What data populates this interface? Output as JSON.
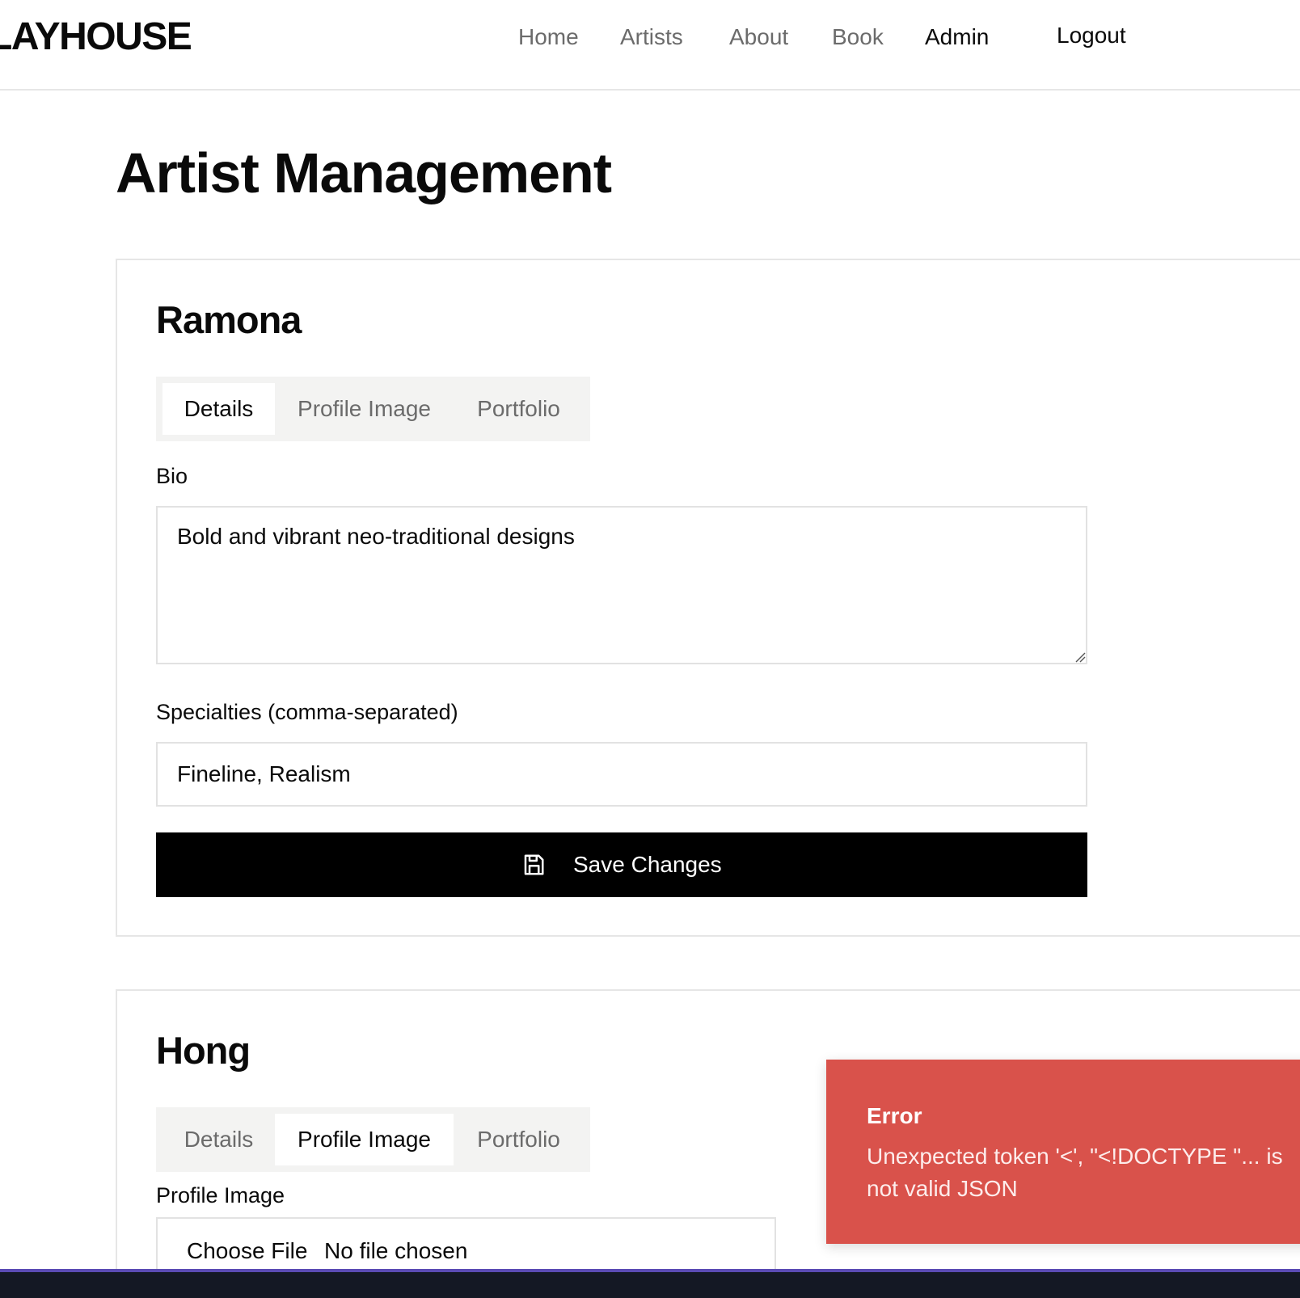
{
  "header": {
    "logo": "LAYHOUSE",
    "nav": {
      "home": "Home",
      "artists": "Artists",
      "about": "About",
      "book": "Book",
      "admin": "Admin"
    },
    "logout": "Logout"
  },
  "page": {
    "title": "Artist Management"
  },
  "artists": [
    {
      "name": "Ramona",
      "tabs": [
        "Details",
        "Profile Image",
        "Portfolio"
      ],
      "active_tab": "Details",
      "bio_label": "Bio",
      "bio": "Bold and vibrant neo-traditional designs",
      "specialties_label": "Specialties (comma-separated)",
      "specialties": "Fineline, Realism",
      "save_label": "Save Changes"
    },
    {
      "name": "Hong",
      "tabs": [
        "Details",
        "Profile Image",
        "Portfolio"
      ],
      "active_tab": "Profile Image",
      "profile_image_label": "Profile Image",
      "choose_file": "Choose File",
      "no_file": "No file chosen"
    }
  ],
  "toast": {
    "title": "Error",
    "message": "Unexpected token '<', \"<!DOCTYPE \"... is not valid JSON"
  },
  "icons": {
    "save": "save-icon",
    "resize": "resize-grip-icon"
  },
  "colors": {
    "error": "#d9524b",
    "primary_button": "#000000",
    "tab_bg": "#f3f3f2"
  }
}
